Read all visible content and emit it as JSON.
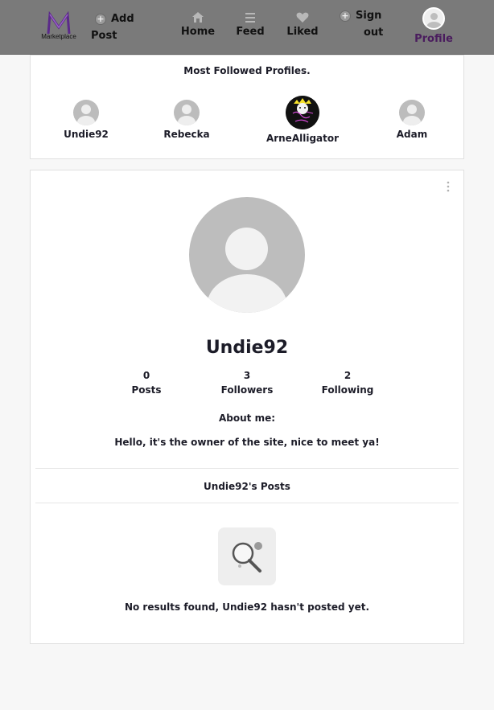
{
  "nav": {
    "logo_text": "Marketplace",
    "add_post": [
      "Add",
      "Post"
    ],
    "home": "Home",
    "feed": "Feed",
    "liked": "Liked",
    "sign_out": [
      "Sign",
      "out"
    ],
    "profile": "Profile",
    "profile_color": "#4a1c5e"
  },
  "most_followed": {
    "title": "Most Followed Profiles.",
    "profiles": [
      {
        "name": "Undie92"
      },
      {
        "name": "Rebecka"
      },
      {
        "name": "ArneAlligator"
      },
      {
        "name": "Adam"
      }
    ]
  },
  "profile": {
    "username": "Undie92",
    "stats": [
      {
        "value": "0",
        "label": "Posts"
      },
      {
        "value": "3",
        "label": "Followers"
      },
      {
        "value": "2",
        "label": "Following"
      }
    ],
    "about_title": "About me:",
    "about_text": "Hello, it's the owner of the site, nice to meet ya!",
    "posts_title": "Undie92's Posts",
    "empty_text": "No results found, Undie92 hasn't posted yet."
  }
}
